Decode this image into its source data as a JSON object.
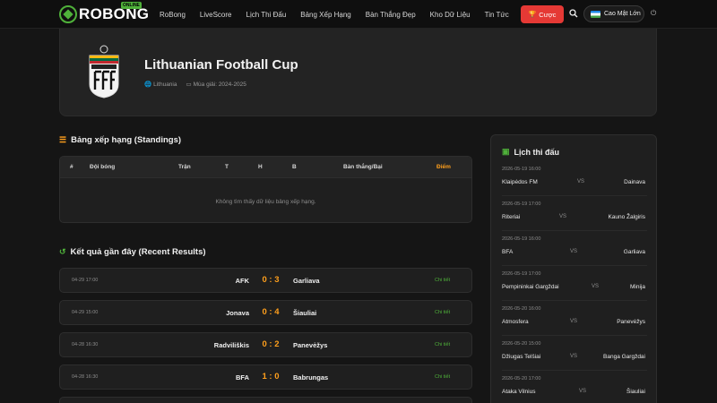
{
  "header": {
    "logo_text": "ROBONG",
    "logo_tag": "ONLINE",
    "nav": [
      "RoBong",
      "LiveScore",
      "Lịch Thi Đấu",
      "Bảng Xếp Hạng",
      "Bàn Thắng Đẹp",
      "Kho Dữ Liệu",
      "Tin Tức"
    ],
    "bet_label": "Cược",
    "lang_label": "Cao Mật Lớn"
  },
  "league": {
    "name": "Lithuanian Football Cup",
    "country": "Lithuania",
    "season": "Mùa giải: 2024-2025",
    "crest_text": "LIETUVOS"
  },
  "standings": {
    "heading": "Bảng xếp hạng (Standings)",
    "columns": [
      "#",
      "Đội bóng",
      "Trận",
      "T",
      "H",
      "B",
      "Bàn thắng/Bại",
      "Điểm"
    ],
    "empty_message": "Không tìm thấy dữ liệu bảng xếp hạng."
  },
  "results": {
    "heading": "Kết quả gần đây (Recent Results)",
    "detail_label": "Chi tiết",
    "rows": [
      {
        "time": "04-29 17:00",
        "home": "AFK",
        "score": "0 : 3",
        "away": "Garliava"
      },
      {
        "time": "04-29 15:00",
        "home": "Jonava",
        "score": "0 : 4",
        "away": "Šiauliai"
      },
      {
        "time": "04-28 16:30",
        "home": "Radviliškis",
        "score": "0 : 2",
        "away": "Panevėžys"
      },
      {
        "time": "04-28 16:30",
        "home": "BFA",
        "score": "1 : 0",
        "away": "Babrungas"
      }
    ]
  },
  "schedule": {
    "heading": "Lịch thi đấu",
    "vs_label": "VS",
    "matches": [
      {
        "time": "2026-05-19 16:00",
        "home": "Klaipėdos FM",
        "away": "Dainava"
      },
      {
        "time": "2026-05-19 17:00",
        "home": "Riteriai",
        "away": "Kauno Žalgiris"
      },
      {
        "time": "2026-05-19 16:00",
        "home": "BFA",
        "away": "Garliava"
      },
      {
        "time": "2026-05-19 17:00",
        "home": "Pempininkai Gargždai",
        "away": "Minija"
      },
      {
        "time": "2026-05-20 16:00",
        "home": "Atmosfera",
        "away": "Panevėžys"
      },
      {
        "time": "2026-05-20 15:00",
        "home": "Džiugas Telšiai",
        "away": "Banga Gargždai"
      },
      {
        "time": "2026-05-20 17:00",
        "home": "Ataka Vilnius",
        "away": "Šiauliai"
      }
    ]
  },
  "colors": {
    "accent_green": "#4fb13a",
    "accent_orange": "#ff9f1c",
    "bet_red": "#e53935"
  }
}
